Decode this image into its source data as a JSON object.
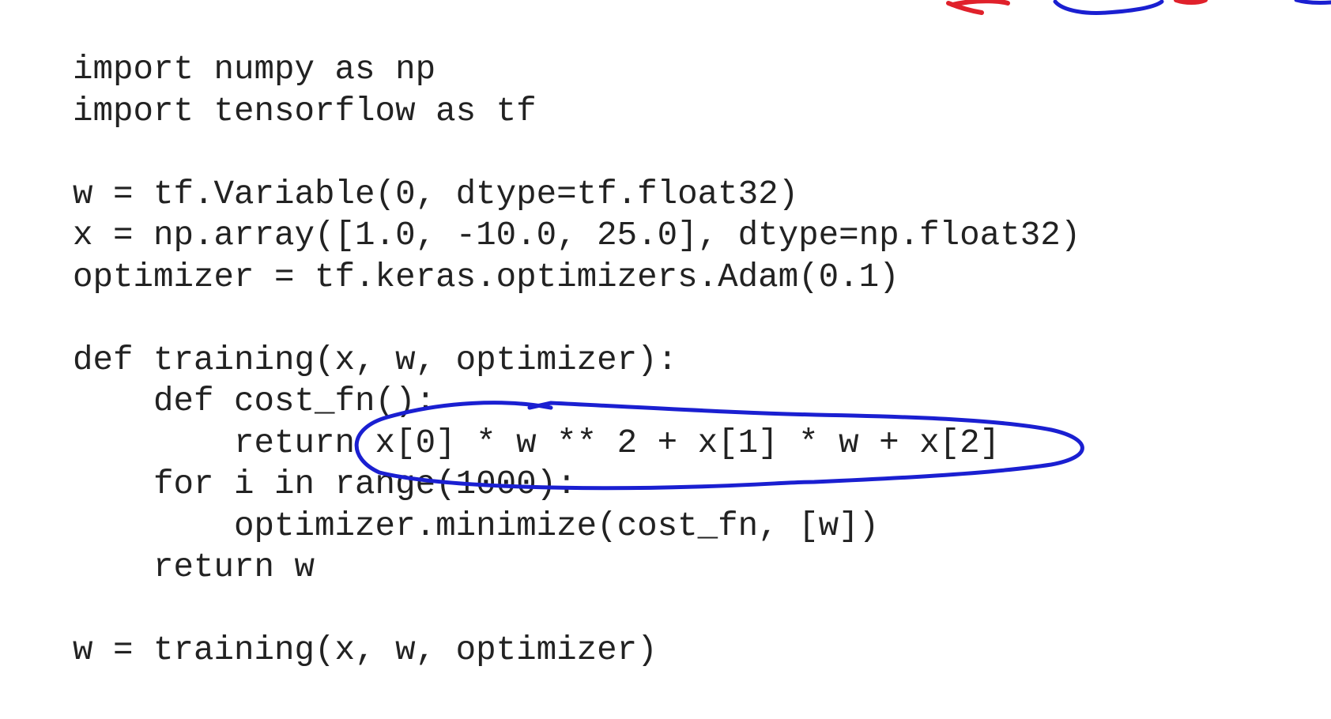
{
  "code": {
    "lines": [
      "import numpy as np",
      "import tensorflow as tf",
      "",
      "w = tf.Variable(0, dtype=tf.float32)",
      "x = np.array([1.0, -10.0, 25.0], dtype=np.float32)",
      "optimizer = tf.keras.optimizers.Adam(0.1)",
      "",
      "def training(x, w, optimizer):",
      "    def cost_fn():",
      "        return x[0] * w ** 2 + x[1] * w + x[2]",
      "    for i in range(1000):",
      "        optimizer.minimize(cost_fn, [w])",
      "    return w",
      "",
      "w = training(x, w, optimizer)"
    ]
  },
  "annotation": {
    "ellipse_color": "#1a1fd1",
    "top_red_color": "#e0212b",
    "top_blue_color": "#1a1fd1"
  }
}
